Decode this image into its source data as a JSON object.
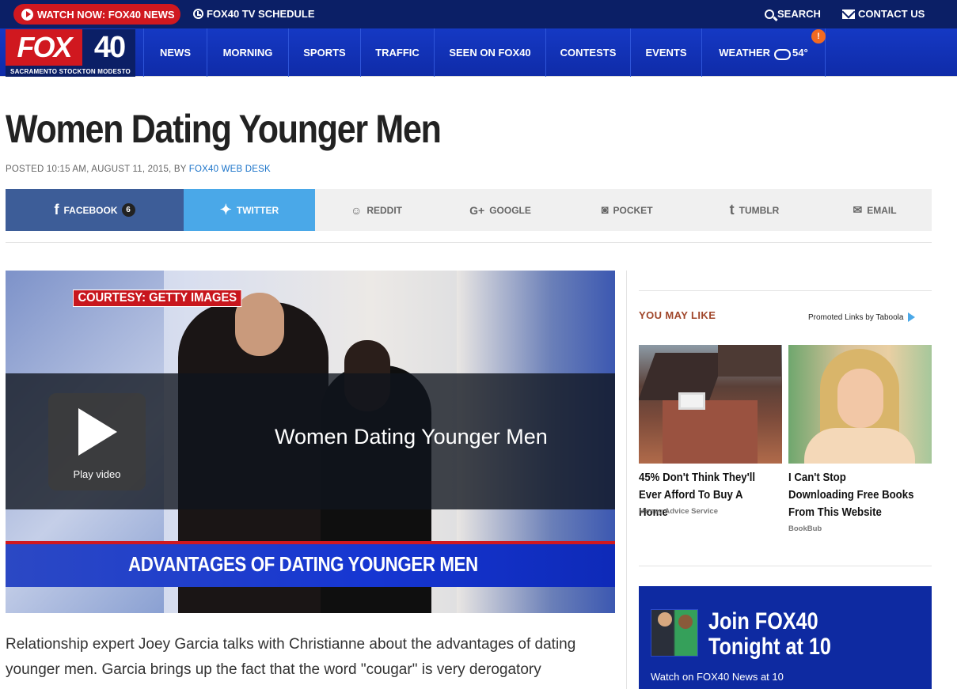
{
  "topbar": {
    "watch_label": "WATCH NOW: FOX40 NEWS",
    "schedule_label": "FOX40 TV SCHEDULE",
    "search_label": "SEARCH",
    "contact_label": "CONTACT US"
  },
  "logo": {
    "fox": "FOX",
    "number": "40",
    "cities": "SACRAMENTO  STOCKTON  MODESTO"
  },
  "nav": {
    "items": [
      "NEWS",
      "MORNING",
      "SPORTS",
      "TRAFFIC",
      "SEEN ON FOX40",
      "CONTESTS",
      "EVENTS"
    ],
    "weather_label": "WEATHER",
    "temperature": "54°",
    "alert_icon": "alert-triangle-icon"
  },
  "article": {
    "title": "Women Dating Younger Men",
    "byline_prefix": "POSTED 10:15 AM, AUGUST 11, 2015, BY",
    "author": "FOX40 WEB DESK",
    "body": "Relationship expert Joey Garcia talks with Christianne about the advantages of dating younger men. Garcia brings up the fact that the word \"cougar\" is very derogatory"
  },
  "share": {
    "facebook": "FACEBOOK",
    "facebook_count": "6",
    "twitter": "TWITTER",
    "reddit": "REDDIT",
    "google": "GOOGLE",
    "pocket": "POCKET",
    "tumblr": "TUMBLR",
    "email": "EMAIL"
  },
  "video": {
    "courtesy": "COURTESY: GETTY IMAGES",
    "title": "Women Dating Younger Men",
    "play_label": "Play video",
    "lower_third": "ADVANTAGES OF DATING YOUNGER MEN"
  },
  "sidebar": {
    "heading": "YOU MAY LIKE",
    "promoted": "Promoted Links by Taboola",
    "cards": [
      {
        "title": "45% Don't Think They'll Ever Afford To Buy A Home",
        "source": "Money Advice Service"
      },
      {
        "title": "I Can't Stop Downloading Free Books From This Website",
        "source": "BookBub"
      }
    ],
    "promo": {
      "headline": "Join FOX40 Tonight at 10",
      "sub": "Watch on FOX40 News at 10"
    }
  },
  "colors": {
    "topbar": "#0b1f66",
    "nav": "#1539c4",
    "accent_red": "#d0181f",
    "facebook": "#3d5d98",
    "twitter": "#4aa8e8",
    "link": "#1a73c9"
  }
}
